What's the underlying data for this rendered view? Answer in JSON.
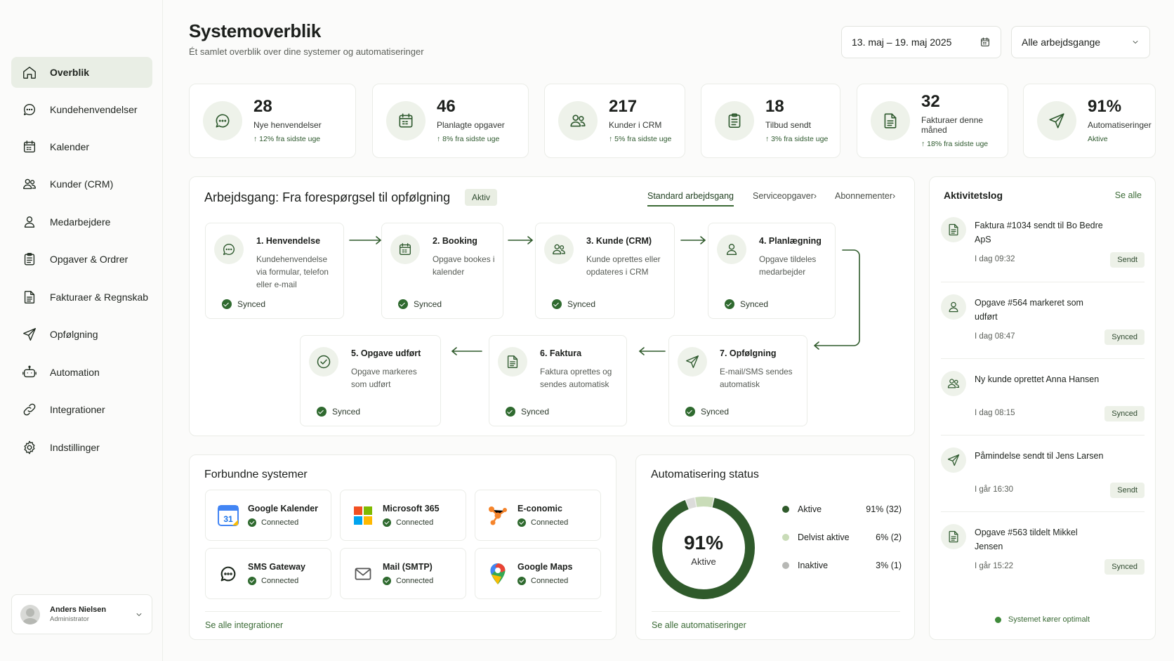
{
  "sidebar": {
    "items": [
      {
        "label": "Overblik",
        "icon": "home-icon",
        "active": true
      },
      {
        "label": "Kundehenvendelser",
        "icon": "chat-icon"
      },
      {
        "label": "Kalender",
        "icon": "calendar-icon"
      },
      {
        "label": "Kunder (CRM)",
        "icon": "users-icon"
      },
      {
        "label": "Medarbejdere",
        "icon": "user-icon"
      },
      {
        "label": "Opgaver & Ordrer",
        "icon": "clipboard-icon"
      },
      {
        "label": "Fakturaer & Regnskab",
        "icon": "invoice-icon"
      },
      {
        "label": "Opfølgning",
        "icon": "send-icon"
      },
      {
        "label": "Automation",
        "icon": "robot-icon"
      },
      {
        "label": "Integrationer",
        "icon": "link-icon"
      },
      {
        "label": "Indstillinger",
        "icon": "gear-icon"
      }
    ],
    "user": {
      "name": "Anders Nielsen",
      "role": "Administrator"
    }
  },
  "header": {
    "title": "Systemoverblik",
    "subtitle": "Ét samlet overblik over dine systemer og automatiseringer",
    "date_range": "13. maj – 19. maj 2025",
    "workflow_filter": "Alle arbejdsgange"
  },
  "stats": [
    {
      "value": "28",
      "label": "Nye henvendelser",
      "change": "12% fra sidste uge",
      "icon": "chat-icon"
    },
    {
      "value": "46",
      "label": "Planlagte opgaver",
      "change": "8% fra sidste uge",
      "icon": "calendar-icon"
    },
    {
      "value": "217",
      "label": "Kunder i CRM",
      "change": "5% fra sidste uge",
      "icon": "users-icon"
    },
    {
      "value": "18",
      "label": "Tilbud sendt",
      "change": "3% fra sidste uge",
      "icon": "clipboard-icon"
    },
    {
      "value": "32",
      "label": "Fakturaer denne måned",
      "change": "18% fra sidste uge",
      "icon": "invoice-icon"
    },
    {
      "value": "91%",
      "label": "Automatiseringer",
      "change": "Aktive",
      "icon": "send-icon"
    }
  ],
  "workflow": {
    "title": "Arbejdsgang: Fra forespørgsel til opfølgning",
    "status": "Aktiv",
    "tabs": [
      "Standard arbejdsgang",
      "Serviceopgaver",
      "Abonnementer"
    ],
    "steps": [
      {
        "title": "1. Henvendelse",
        "desc": "Kundehenvendelse via formular, telefon eller e-mail",
        "status": "Synced",
        "icon": "chat-icon"
      },
      {
        "title": "2. Booking",
        "desc": "Opgave bookes i kalender",
        "status": "Synced",
        "icon": "calendar-icon"
      },
      {
        "title": "3. Kunde (CRM)",
        "desc": "Kunde oprettes eller opdateres i CRM",
        "status": "Synced",
        "icon": "users-icon"
      },
      {
        "title": "4. Planlægning",
        "desc": "Opgave tildeles medarbejder",
        "status": "Synced",
        "icon": "user-icon"
      },
      {
        "title": "5. Opgave udført",
        "desc": "Opgave markeres som udført",
        "status": "Synced",
        "icon": "check-circle-icon"
      },
      {
        "title": "6. Faktura",
        "desc": "Faktura oprettes og sendes automatisk",
        "status": "Synced",
        "icon": "invoice-icon"
      },
      {
        "title": "7. Opfølgning",
        "desc": "E-mail/SMS sendes automatisk",
        "status": "Synced",
        "icon": "send-icon"
      }
    ]
  },
  "systems": {
    "title": "Forbundne systemer",
    "items": [
      {
        "name": "Google Kalender",
        "status": "Connected",
        "logo": "google-calendar-icon"
      },
      {
        "name": "Microsoft 365",
        "status": "Connected",
        "logo": "microsoft-icon"
      },
      {
        "name": "E-conomic",
        "status": "Connected",
        "logo": "economic-icon"
      },
      {
        "name": "SMS Gateway",
        "status": "Connected",
        "logo": "sms-icon"
      },
      {
        "name": "Mail (SMTP)",
        "status": "Connected",
        "logo": "mail-icon"
      },
      {
        "name": "Google Maps",
        "status": "Connected",
        "logo": "maps-pin-icon"
      }
    ],
    "link": "Se alle integrationer"
  },
  "automation": {
    "title": "Automatisering status",
    "center_value": "91%",
    "center_label": "Aktive",
    "segments": [
      {
        "label": "Aktive",
        "value": "91% (32)",
        "pct": 91,
        "color": "#2f5a2b"
      },
      {
        "label": "Delvist aktive",
        "value": "6% (2)",
        "pct": 6,
        "color": "#c9dcb8"
      },
      {
        "label": "Inaktive",
        "value": "3% (1)",
        "pct": 3,
        "color": "#dcdcda"
      }
    ],
    "link": "Se alle automatiseringer"
  },
  "activity": {
    "title": "Aktivitetslog",
    "see_all": "Se alle",
    "items": [
      {
        "text": "Faktura #1034 sendt til Bo Bedre ApS",
        "time": "I dag 09:32",
        "badge": "Sendt",
        "icon": "invoice-icon"
      },
      {
        "text": "Opgave #564 markeret som udført",
        "time": "I dag 08:47",
        "badge": "Synced",
        "icon": "user-icon"
      },
      {
        "text": "Ny kunde oprettet Anna Hansen",
        "time": "I dag 08:15",
        "badge": "Synced",
        "icon": "users-icon"
      },
      {
        "text": "Påmindelse sendt til Jens Larsen",
        "time": "I går 16:30",
        "badge": "Sendt",
        "icon": "send-icon"
      },
      {
        "text": "Opgave #563 tildelt Mikkel Jensen",
        "time": "I går 15:22",
        "badge": "Synced",
        "icon": "invoice-icon"
      }
    ],
    "system_status": "Systemet kører optimalt"
  },
  "colors": {
    "accent": "#2f5a2b",
    "accent_light": "#eef2ea",
    "active_nav": "#e9eee5"
  }
}
